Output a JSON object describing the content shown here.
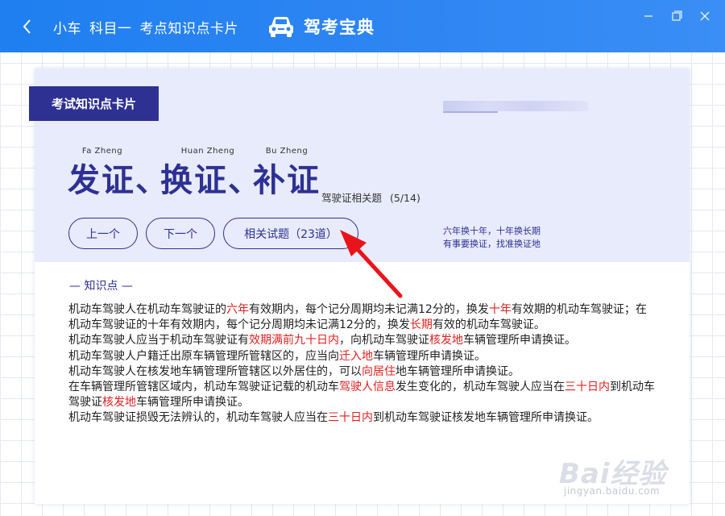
{
  "titlebar": {
    "back_icon": "chevron-left-icon",
    "title_parts": [
      "小车",
      "科目一",
      "考点知识点卡片"
    ],
    "brand_name": "驾考宝典",
    "brand_icon": "car-icon",
    "controls": [
      "minimize-icon",
      "restore-icon",
      "close-icon"
    ],
    "bg_color": "#2a84f2"
  },
  "card": {
    "tab_label": "考试知识点卡片",
    "heading_words": [
      {
        "pinyin": "Fa Zheng",
        "chars": "发证、"
      },
      {
        "pinyin": "Huan Zheng",
        "chars": "换证、"
      },
      {
        "pinyin": "Bu Zheng",
        "chars": "补证"
      }
    ],
    "subtitle": "驾驶证相关题",
    "subtitle_count": "(5/14)",
    "buttons": {
      "prev": "上一个",
      "next": "下一个",
      "related": "相关试题（23道）"
    },
    "mnemonic": [
      "六年换十年，十年换长期",
      "有事要换证，找准换证地"
    ],
    "accent_color": "#2e3192"
  },
  "knowledge": {
    "section_title": "— 知识点 —",
    "highlight_color": "#e02020",
    "paragraphs": [
      [
        {
          "t": "机动车驾驶人在机动车驾驶证的"
        },
        {
          "t": "六年",
          "hl": true
        },
        {
          "t": "有效期内，每个记分周期均未记满12分的，换发"
        },
        {
          "t": "十年",
          "hl": true
        },
        {
          "t": "有效期的机动车驾驶证；在机动车驾驶证的十年有效期内，每个记分周期均未记满12分的，换发"
        },
        {
          "t": "长期",
          "hl": true
        },
        {
          "t": "有效的机动车驾驶证。"
        }
      ],
      [
        {
          "t": "机动车驾驶人应当于机动车驾驶证有"
        },
        {
          "t": "效期满前九十日内",
          "hl": true
        },
        {
          "t": "，向机动车驾驶证"
        },
        {
          "t": "核发地",
          "hl": true
        },
        {
          "t": "车辆管理所申请换证。"
        }
      ],
      [
        {
          "t": "机动车驾驶人户籍迁出原车辆管理所管辖区的，应当向"
        },
        {
          "t": "迁入地",
          "hl": true
        },
        {
          "t": "车辆管理所申请换证。"
        }
      ],
      [
        {
          "t": "机动车驾驶人在核发地车辆管理所管辖区以外居住的，可以"
        },
        {
          "t": "向居住",
          "hl": true
        },
        {
          "t": "地车辆管理所申请换证。"
        }
      ],
      [
        {
          "t": "在车辆管理所管辖区域内，机动车驾驶证记载的机动车"
        },
        {
          "t": "驾驶人信息",
          "hl": true
        },
        {
          "t": "发生变化的，机动车驾驶人应当在"
        },
        {
          "t": "三十日内",
          "hl": true
        },
        {
          "t": "到机动车驾驶证"
        },
        {
          "t": "核发地",
          "hl": true
        },
        {
          "t": "车辆管理所申请换证。"
        }
      ],
      [
        {
          "t": "机动车驾驶证损毁无法辨认的，机动车驾驶人应当在"
        },
        {
          "t": "三十日内",
          "hl": true
        },
        {
          "t": "到机动车驾驶证核发地车辆管理所申请换证。"
        }
      ]
    ]
  },
  "annotation": {
    "arrow_icon": "red-arrow-icon",
    "arrow_color": "#e8141c"
  },
  "watermark": {
    "main": "Bai经验",
    "sub": "jingyan.baidu.com"
  }
}
